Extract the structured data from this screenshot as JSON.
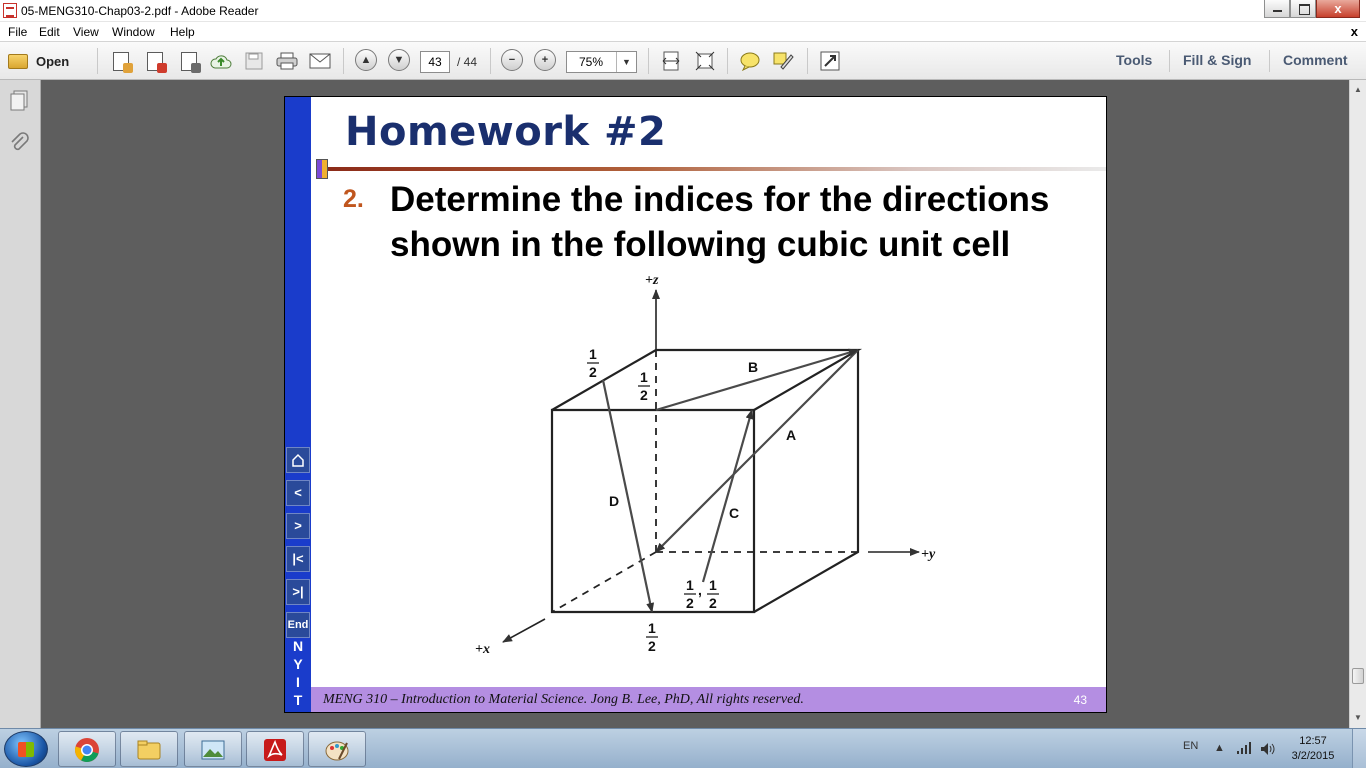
{
  "window": {
    "title": "05-MENG310-Chap03-2.pdf - Adobe Reader",
    "controls": {
      "minimize": "minimize",
      "maximize": "maximize",
      "close": "x"
    }
  },
  "menu": {
    "items": [
      "File",
      "Edit",
      "View",
      "Window",
      "Help"
    ],
    "doc_close": "x"
  },
  "toolbar": {
    "open_label": "Open",
    "page_current": "43",
    "page_total": "/ 44",
    "zoom": "75%",
    "right_links": [
      "Tools",
      "Fill & Sign",
      "Comment"
    ]
  },
  "slide": {
    "title": "Homework #2",
    "item_number": "2.",
    "item_text": "Determine the indices for the directions shown in the following cubic unit cell",
    "nav_buttons": [
      "home",
      "<",
      ">",
      "|<",
      ">|",
      "End"
    ],
    "nav_end_label": "End",
    "logo_letters": [
      "N",
      "Y",
      "I",
      "T"
    ],
    "footer_text": "MENG 310 – Introduction to Material Science. Jong B. Lee, PhD, All rights reserved.",
    "page_number": "43"
  },
  "figure": {
    "axis_labels": {
      "z": "+z",
      "y": "+y",
      "x": "+x"
    },
    "direction_labels": [
      "A",
      "B",
      "C",
      "D"
    ],
    "fraction_numerator": "1",
    "fraction_denominator": "2",
    "comma": ","
  },
  "taskbar": {
    "apps": [
      "chrome",
      "explorer",
      "photos",
      "adobe-reader",
      "paint"
    ],
    "language": "EN",
    "time": "12:57",
    "date": "3/2/2015"
  },
  "colors": {
    "slide_title": "#1a2f6e",
    "sidebar_blue": "#1a3ccb",
    "footer_purple": "#b48ee2",
    "item_number": "#c0561e",
    "link_text": "#4a5a73"
  }
}
